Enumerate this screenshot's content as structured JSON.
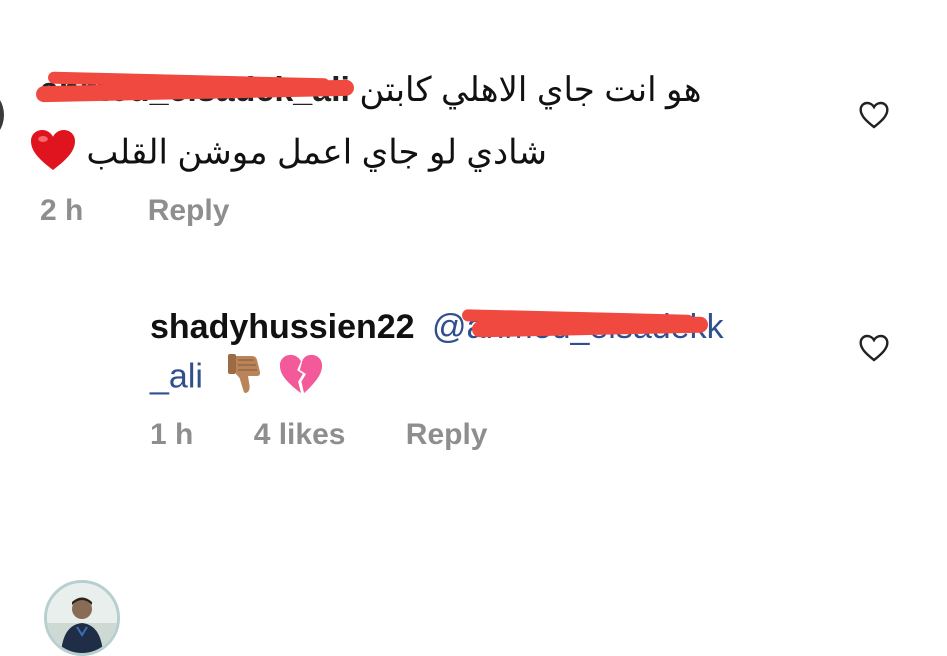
{
  "comments": [
    {
      "username": "ahmed_elsadek_ali",
      "username_suffix": "ali",
      "text_line1": "هو انت جاي الاهلي كابتن",
      "text_line2": "شادي لو جاي اعمل موشن القلب",
      "emoji": "❤️",
      "time": "2 h",
      "reply_label": "Reply",
      "like_icon": "heart-outline-icon"
    },
    {
      "username": "shadyhussien22",
      "mention": "@ahmed_elsadek",
      "mention_tail": "k",
      "mention_line2": "_ali",
      "emojis": [
        "👎🏽",
        "💔"
      ],
      "time": "1 h",
      "likes": "4 likes",
      "reply_label": "Reply",
      "like_icon": "heart-outline-icon"
    }
  ],
  "colors": {
    "meta_gray": "#8e8e8e",
    "mention_blue": "#2f4f8f",
    "redaction_red": "#f0493f",
    "heart_red": "#e0141f",
    "broken_heart_pink": "#f25a9a"
  }
}
